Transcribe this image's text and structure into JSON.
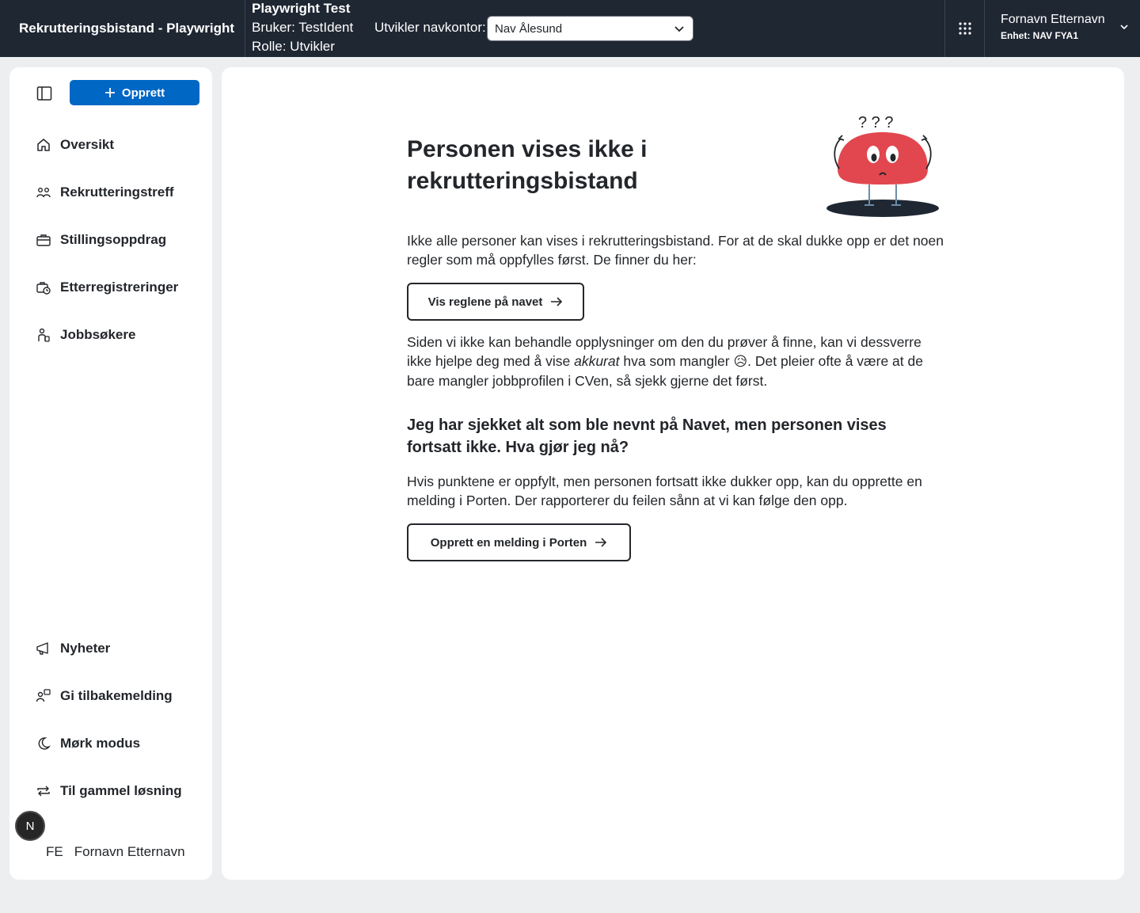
{
  "header": {
    "app_title": "Rekrutteringsbistand - Playwright",
    "dev_name": "Playwright Test",
    "dev_user": "Bruker: TestIdent",
    "dev_role": "Rolle: Utvikler",
    "office_label": "Utvikler navkontor:",
    "office_value": "Nav Ålesund",
    "user_name": "Fornavn Etternavn",
    "user_unit": "Enhet: NAV FYA1"
  },
  "sidebar": {
    "create_label": "Opprett",
    "items": [
      {
        "label": "Oversikt",
        "icon": "home-icon"
      },
      {
        "label": "Rekrutteringstreff",
        "icon": "people-icon"
      },
      {
        "label": "Stillingsoppdrag",
        "icon": "briefcase-icon"
      },
      {
        "label": "Etterregistreringer",
        "icon": "briefcase-clock-icon"
      },
      {
        "label": "Jobbsøkere",
        "icon": "person-icon"
      }
    ],
    "bottom_items": [
      {
        "label": "Nyheter",
        "icon": "megaphone-icon"
      },
      {
        "label": "Gi tilbakemelding",
        "icon": "feedback-icon"
      },
      {
        "label": "Mørk modus",
        "icon": "moon-icon"
      },
      {
        "label": "Til gammel løsning",
        "icon": "arrows-swap-icon"
      }
    ],
    "avatar_letter": "N",
    "user_initials": "FE",
    "user_name": "Fornavn Etternavn"
  },
  "main": {
    "title": "Personen vises ikke i rekrutteringsbistand",
    "intro": "Ikke alle personer kan vises i rekrutteringsbistand. For at de skal dukke opp er det noen regler som må oppfylles først. De finner du her:",
    "rules_button": "Vis reglene på navet",
    "explain_part1": "Siden vi ikke kan behandle opplysninger om den du prøver å finne, kan vi dessverre ikke hjelpe deg med å vise ",
    "explain_emphasis": "akkurat",
    "explain_part2": " hva som mangler ",
    "explain_emoji": "😥",
    "explain_part3": ". Det pleier ofte å være at de bare mangler jobbprofilen i CVen, så sjekk gjerne det først.",
    "sub_heading": "Jeg har sjekket alt som ble nevnt på Navet, men personen vises fortsatt ikke. Hva gjør jeg nå?",
    "help_text": "Hvis punktene er oppfylt, men personen fortsatt ikke dukker opp, kan du opprette en melding i Porten. Der rapporterer du feilen sånn at vi kan følge den opp.",
    "porten_button": "Opprett en melding i Porten",
    "illustration_text": "? ? ?"
  },
  "colors": {
    "header_bg": "#1f2733",
    "accent": "#0067c5",
    "figure_red": "#e2474f"
  }
}
